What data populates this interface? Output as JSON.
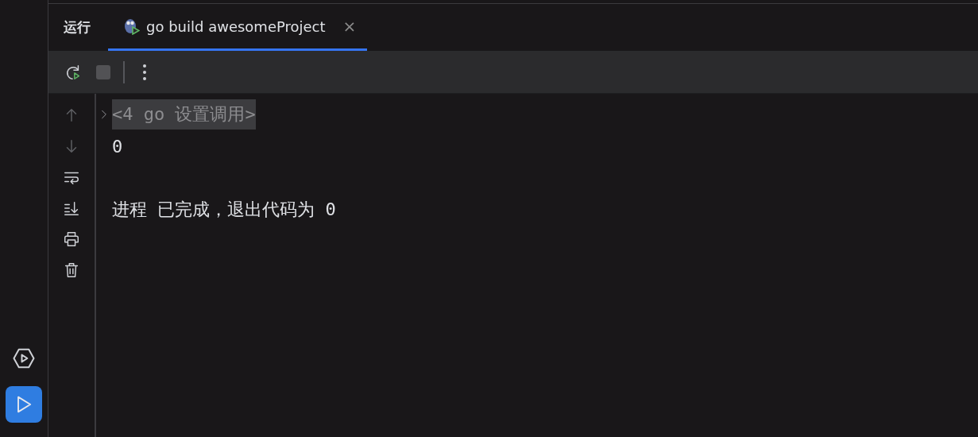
{
  "stripe": [
    {
      "kind": "services",
      "selected": false
    },
    {
      "kind": "run",
      "selected": true
    }
  ],
  "tool_window": {
    "title": "运行",
    "tabs": [
      {
        "label": "go build awesomeProject",
        "selected": true,
        "close_label": "×"
      }
    ]
  },
  "toolbar": [
    {
      "kind": "rerun"
    },
    {
      "kind": "stop",
      "disabled": true
    },
    {
      "kind": "separator"
    },
    {
      "kind": "more"
    }
  ],
  "gutter": [
    {
      "kind": "up",
      "disabled": true
    },
    {
      "kind": "down",
      "disabled": true
    },
    {
      "kind": "wrap",
      "disabled": false
    },
    {
      "kind": "scroll-end",
      "disabled": false
    },
    {
      "kind": "print",
      "disabled": false
    },
    {
      "kind": "clear",
      "disabled": false
    }
  ],
  "console": [
    {
      "kind": "folded",
      "text": "<4 go 设置调用>",
      "expanded": false
    },
    {
      "kind": "output",
      "text": "0"
    },
    {
      "kind": "blank"
    },
    {
      "kind": "output",
      "text": "进程 已完成，退出代码为 0"
    }
  ]
}
